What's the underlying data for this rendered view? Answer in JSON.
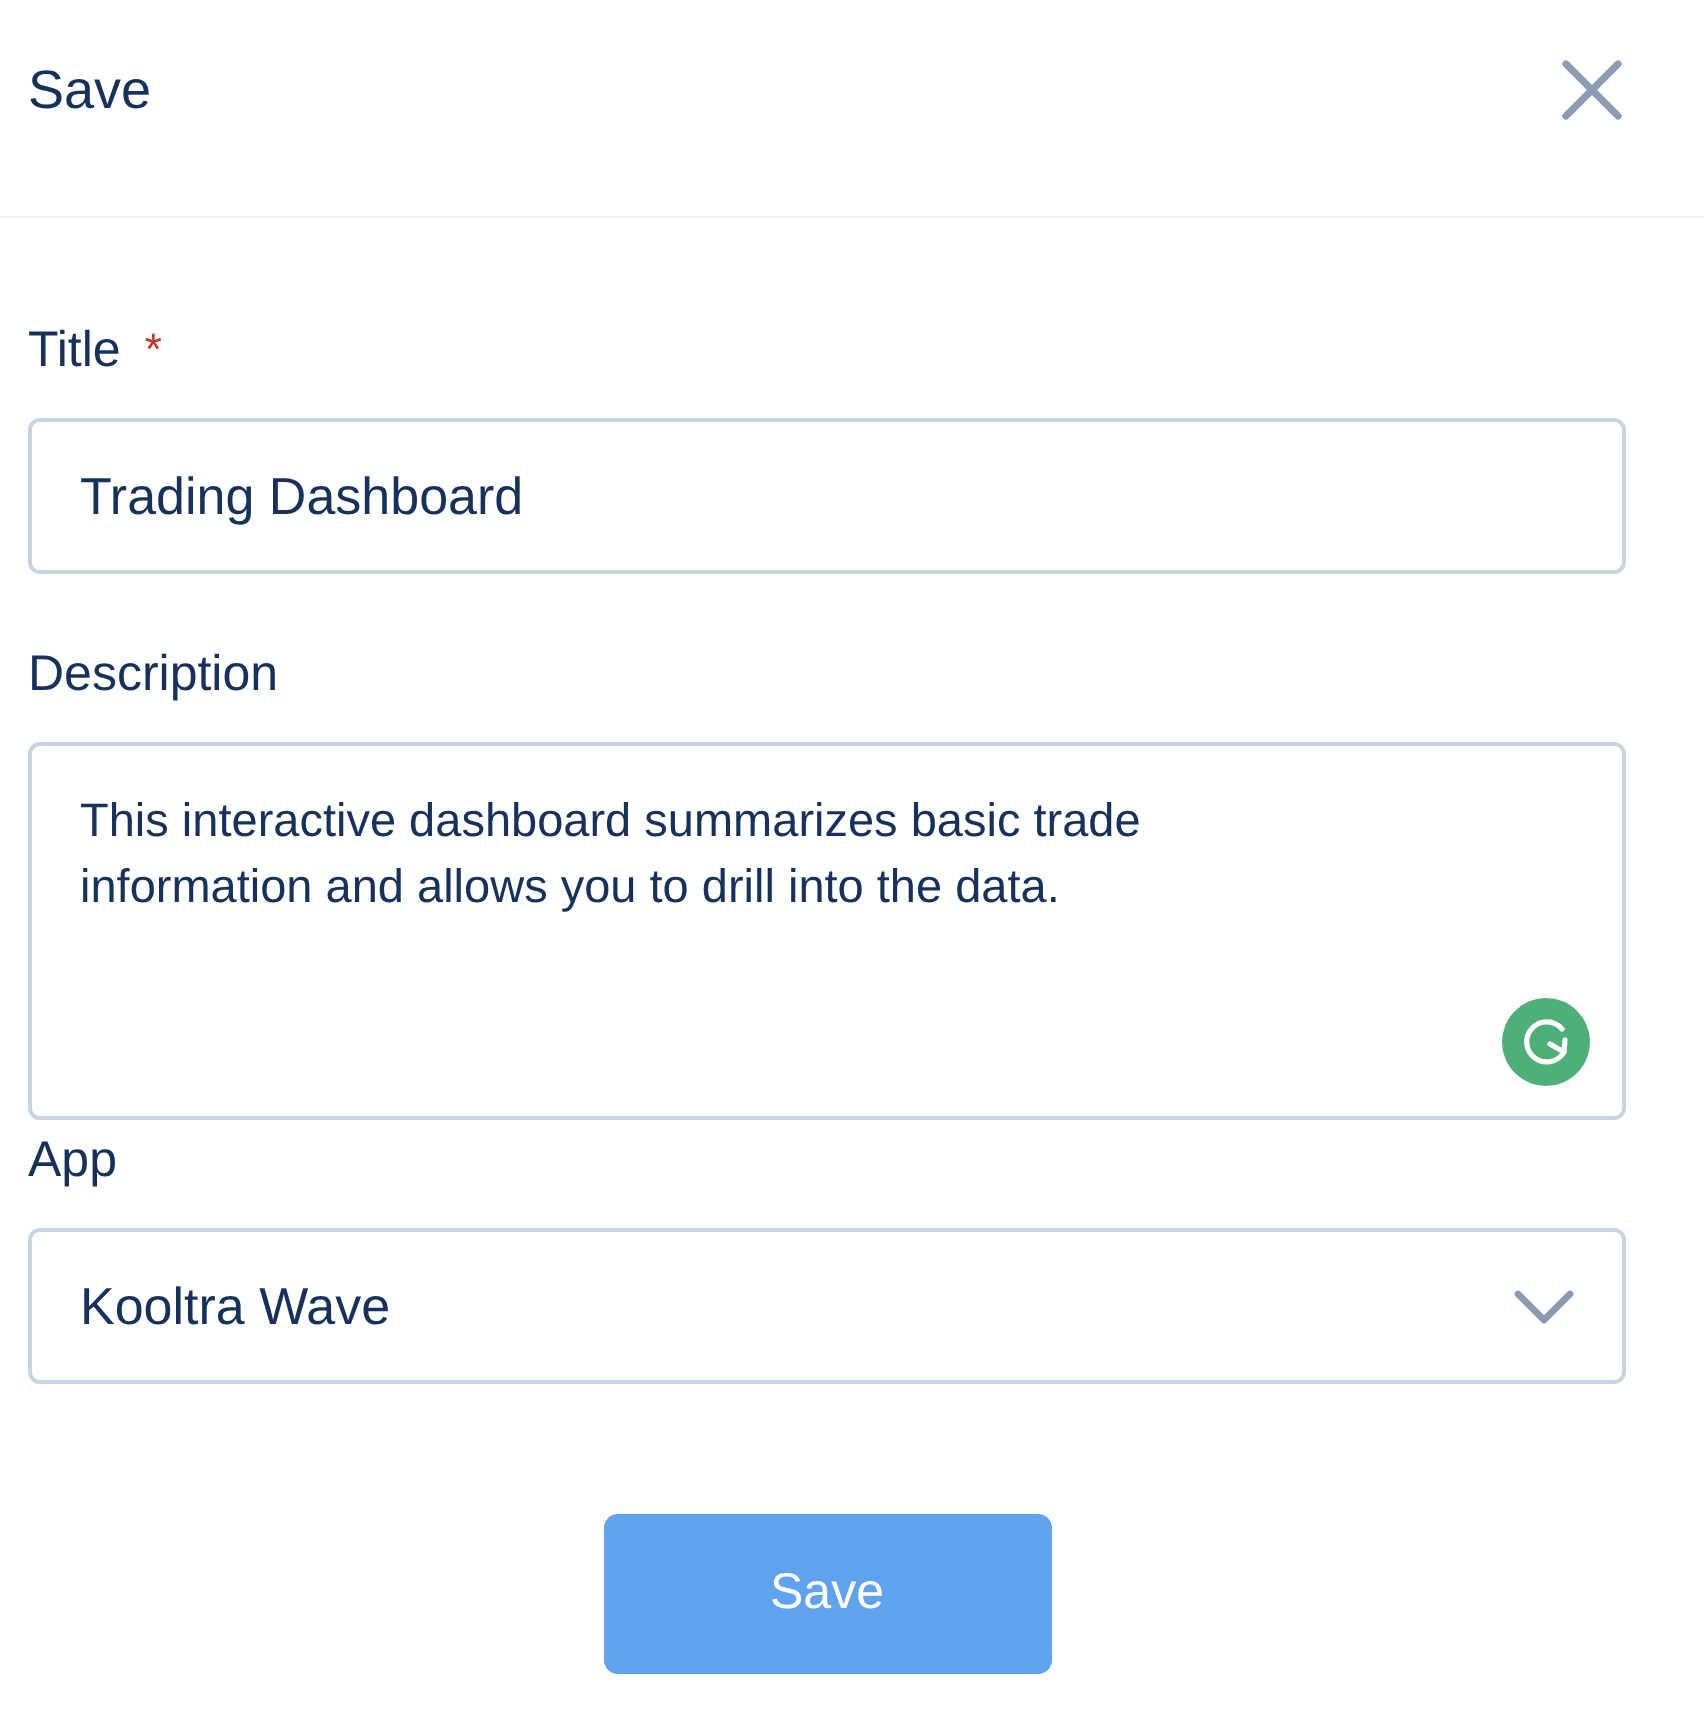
{
  "dialog": {
    "title": "Save"
  },
  "fields": [
    {
      "kind": "text",
      "label": "Title",
      "required_mark": "*",
      "value": "Trading Dashboard"
    },
    {
      "kind": "textarea",
      "label": "Description",
      "value": "This interactive dashboard summarizes basic trade information and allows you to drill into the data."
    },
    {
      "kind": "select",
      "label": "App",
      "value": "Kooltra Wave"
    }
  ],
  "buttons": [
    {
      "label": "Save"
    }
  ]
}
